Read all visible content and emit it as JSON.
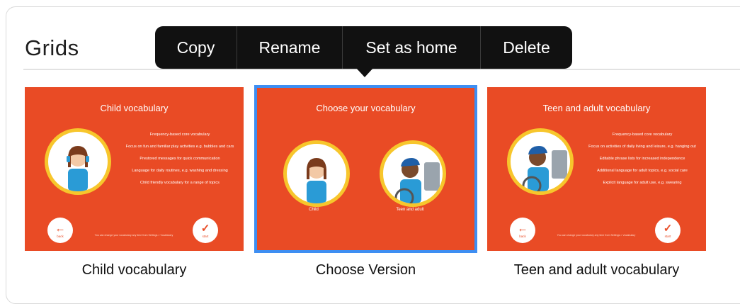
{
  "header": {
    "title": "Grids"
  },
  "context_menu": {
    "items": [
      "Copy",
      "Rename",
      "Set as home",
      "Delete"
    ]
  },
  "colors": {
    "card_bg": "#e94b25",
    "selection": "#3e8ef2",
    "ring": "#f7c62c"
  },
  "cards": [
    {
      "caption": "Child vocabulary",
      "thumb_title": "Child vocabulary",
      "bullets": [
        "Frequency-based core vocabulary",
        "Focus on fun and familiar play activities e.g. bubbles and cars",
        "Prestored messages for quick communication",
        "Language for daily routines, e.g. washing and dressing",
        "Child friendly vocabulary for a range of topics"
      ],
      "back_label": "back",
      "start_label": "start",
      "footnote": "You can change your vocabulary any time from Settings > Vocabulary"
    },
    {
      "caption": "Choose Version",
      "thumb_title": "Choose your vocabulary",
      "option_child": "Child",
      "option_teen": "Teen and adult",
      "selected": true
    },
    {
      "caption": "Teen and adult vocabulary",
      "thumb_title": "Teen and adult vocabulary",
      "bullets": [
        "Frequency-based core vocabulary",
        "Focus on activities of daily living and leisure, e.g. hanging out",
        "Editable phrase lists for increased independence",
        "Additional language for adult topics, e.g. social care",
        "Explicit language for adult use, e.g. swearing"
      ],
      "back_label": "back",
      "start_label": "start",
      "footnote": "You can change your vocabulary any time from Settings > Vocabulary"
    }
  ]
}
